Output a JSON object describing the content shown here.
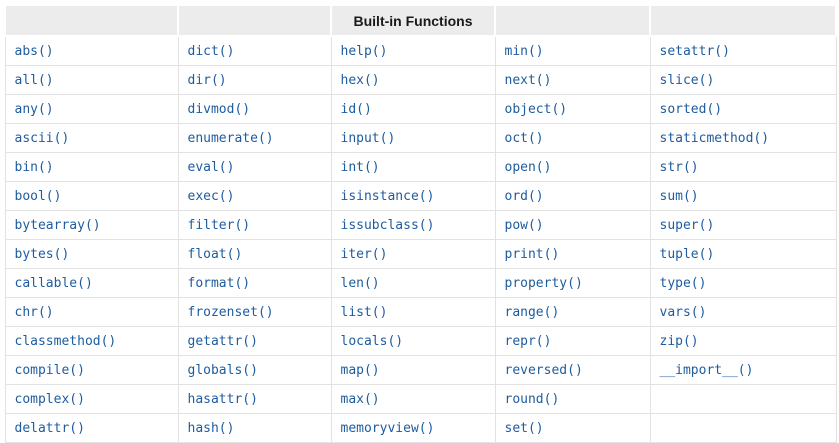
{
  "table": {
    "title": "Built-in Functions",
    "columns": [
      [
        "abs()",
        "all()",
        "any()",
        "ascii()",
        "bin()",
        "bool()",
        "bytearray()",
        "bytes()",
        "callable()",
        "chr()",
        "classmethod()",
        "compile()",
        "complex()",
        "delattr()"
      ],
      [
        "dict()",
        "dir()",
        "divmod()",
        "enumerate()",
        "eval()",
        "exec()",
        "filter()",
        "float()",
        "format()",
        "frozenset()",
        "getattr()",
        "globals()",
        "hasattr()",
        "hash()"
      ],
      [
        "help()",
        "hex()",
        "id()",
        "input()",
        "int()",
        "isinstance()",
        "issubclass()",
        "iter()",
        "len()",
        "list()",
        "locals()",
        "map()",
        "max()",
        "memoryview()"
      ],
      [
        "min()",
        "next()",
        "object()",
        "oct()",
        "open()",
        "ord()",
        "pow()",
        "print()",
        "property()",
        "range()",
        "repr()",
        "reversed()",
        "round()",
        "set()"
      ],
      [
        "setattr()",
        "slice()",
        "sorted()",
        "staticmethod()",
        "str()",
        "sum()",
        "super()",
        "tuple()",
        "type()",
        "vars()",
        "zip()",
        "__import__()",
        "",
        ""
      ]
    ]
  },
  "colors": {
    "link": "#1e5c9f",
    "header_bg": "#ececec",
    "border": "#e2e2e2",
    "header_text": "#1a1a1a",
    "page_bg": "#ffffff"
  }
}
